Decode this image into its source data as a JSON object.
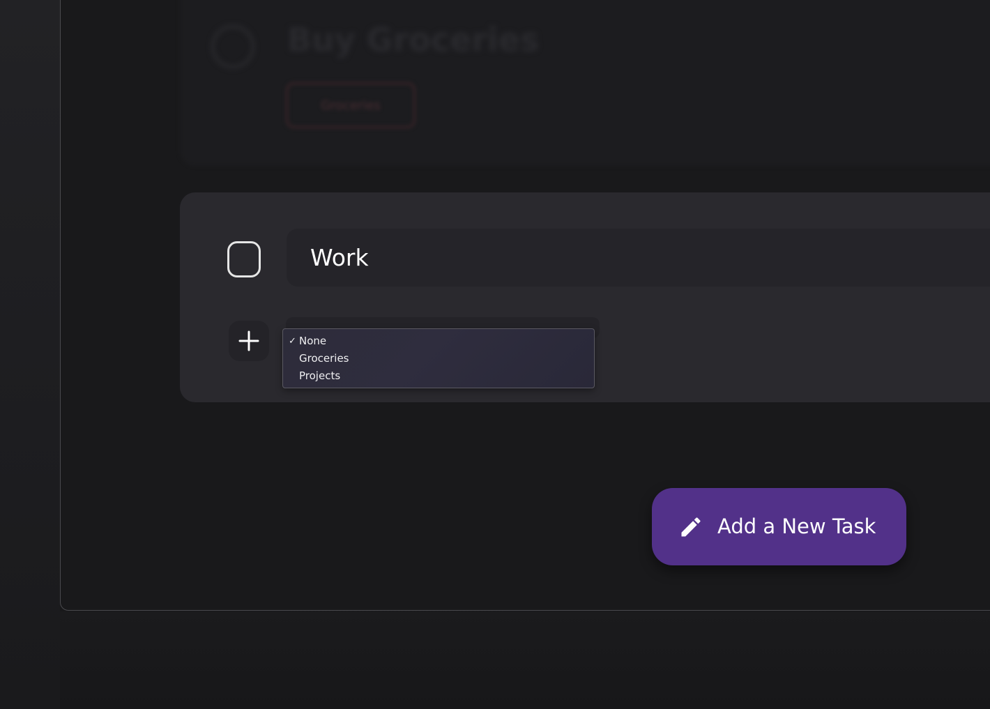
{
  "previous_task": {
    "title": "Buy Groceries",
    "category_tag": "Groceries"
  },
  "current_task": {
    "name_value": "Work",
    "completed": false
  },
  "category_dropdown": {
    "options": [
      {
        "label": "None",
        "selected": true,
        "check": "✓"
      },
      {
        "label": "Groceries",
        "selected": false,
        "check": ""
      },
      {
        "label": "Projects",
        "selected": false,
        "check": ""
      }
    ]
  },
  "add_task_button": {
    "label": "Add a New Task",
    "icon": "pencil-icon"
  },
  "colors": {
    "accent": "#523189",
    "card_bg": "#2a292e",
    "app_bg": "#19191b"
  }
}
